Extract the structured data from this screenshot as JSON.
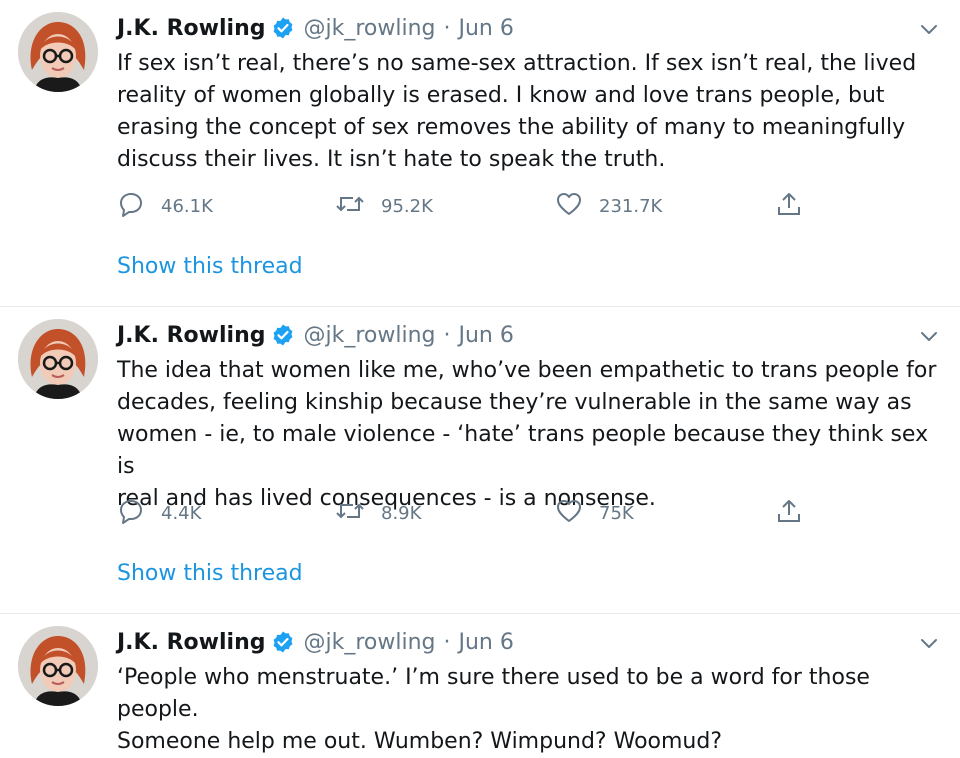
{
  "tweets": [
    {
      "author": "J.K. Rowling",
      "handle": "@jk_rowling",
      "separator": "·",
      "date": "Jun 6",
      "text": "If sex isn’t real, there’s no same-sex attraction. If sex isn’t real, the lived\nreality of women globally is erased. I know and love trans people, but\nerasing the concept of sex removes the ability of many to meaningfully\ndiscuss their lives. It isn’t hate to speak the truth.",
      "replies": "46.1K",
      "retweets": "95.2K",
      "likes": "231.7K",
      "show_thread": "Show this thread"
    },
    {
      "author": "J.K. Rowling",
      "handle": "@jk_rowling",
      "separator": "·",
      "date": "Jun 6",
      "text": "The idea that women like me, who’ve been empathetic to trans people for\ndecades, feeling kinship because they’re vulnerable in the same way as\nwomen - ie, to male violence - ‘hate’ trans people because they think sex is\nreal and has lived consequences - is a nonsense.",
      "replies": "4.4K",
      "retweets": "8.9K",
      "likes": "75K",
      "show_thread": "Show this thread"
    },
    {
      "author": "J.K. Rowling",
      "handle": "@jk_rowling",
      "separator": "·",
      "date": "Jun 6",
      "text": "‘People who menstruate.’ I’m sure there used to be a word for those people.\nSomeone help me out. Wumben? Wimpund? Woomud?"
    }
  ],
  "colors": {
    "link": "#1b95e0",
    "secondary_text": "#657786",
    "verified_badge": "#1da1f2",
    "divider": "#e6ecf0"
  },
  "icons": {
    "reply": "reply-icon",
    "retweet": "retweet-icon",
    "like": "heart-icon",
    "share": "share-icon",
    "caret": "chevron-down-icon",
    "verified": "verified-badge-icon"
  }
}
